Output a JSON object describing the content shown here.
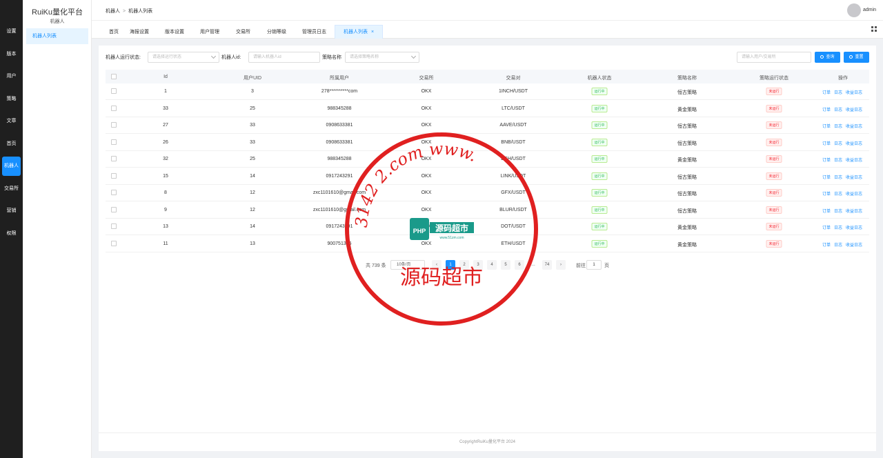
{
  "nav": {
    "items": [
      "设置",
      "版本",
      "用户",
      "策略",
      "文章",
      "首页",
      "机器人",
      "交易所",
      "营销",
      "权限"
    ],
    "active": "机器人"
  },
  "sidebar": {
    "brand": "RuiKu量化平台",
    "section": "机器人",
    "menu": "机器人列表"
  },
  "header": {
    "breadcrumb": [
      "机器人",
      "机器人列表"
    ],
    "separator": ">",
    "user": "admin"
  },
  "tabs": [
    {
      "label": "首页"
    },
    {
      "label": "海报设置"
    },
    {
      "label": "版本设置"
    },
    {
      "label": "用户管理"
    },
    {
      "label": "交易所"
    },
    {
      "label": "分销等级"
    },
    {
      "label": "管理员日志"
    },
    {
      "label": "机器人列表",
      "close": "×"
    }
  ],
  "filters": {
    "status_label": "机器人运行状态:",
    "status_placeholder": "请选择运行状态",
    "robot_id_label": "机器人id:",
    "robot_id_placeholder": "请输入机器人id",
    "strategy_label": "策略名称",
    "strategy_placeholder": "请选择策略名称",
    "user_search_placeholder": "请输入用户/交易所",
    "search_button": "查询",
    "reset_button": "重置"
  },
  "table": {
    "columns": [
      "Id",
      "用户UID",
      "所属用户",
      "交易所",
      "交易对",
      "机器人状态",
      "策略名称",
      "策略运行状态",
      "操作"
    ],
    "actions": [
      "订单",
      "日志",
      "收益日志"
    ],
    "rows": [
      {
        "id": "1",
        "uid": "3",
        "user": "278**********com",
        "exchange": "OKX",
        "pair": "1INCH/USDT",
        "robot_status": "运行中",
        "strategy": "恒古策略",
        "strategy_status": "未运行"
      },
      {
        "id": "33",
        "uid": "25",
        "user": "988345288",
        "exchange": "OKX",
        "pair": "LTC/USDT",
        "robot_status": "运行中",
        "strategy": "黄金策略",
        "strategy_status": "未运行"
      },
      {
        "id": "27",
        "uid": "33",
        "user": "0908633381",
        "exchange": "OKX",
        "pair": "AAVE/USDT",
        "robot_status": "运行中",
        "strategy": "恒古策略",
        "strategy_status": "未运行"
      },
      {
        "id": "26",
        "uid": "33",
        "user": "0908633381",
        "exchange": "OKX",
        "pair": "BNB/USDT",
        "robot_status": "运行中",
        "strategy": "恒古策略",
        "strategy_status": "未运行"
      },
      {
        "id": "32",
        "uid": "25",
        "user": "988345288",
        "exchange": "OKX",
        "pair": "BCH/USDT",
        "robot_status": "运行中",
        "strategy": "黄金策略",
        "strategy_status": "未运行"
      },
      {
        "id": "15",
        "uid": "14",
        "user": "0917243291",
        "exchange": "OKX",
        "pair": "LINK/USDT",
        "robot_status": "运行中",
        "strategy": "恒古策略",
        "strategy_status": "未运行"
      },
      {
        "id": "8",
        "uid": "12",
        "user": "zxc1101610@gmail.com",
        "exchange": "OKX",
        "pair": "GFX/USDT",
        "robot_status": "运行中",
        "strategy": "恒古策略",
        "strategy_status": "未运行"
      },
      {
        "id": "9",
        "uid": "12",
        "user": "zxc1101610@gmail.com",
        "exchange": "OKX",
        "pair": "BLUR/USDT",
        "robot_status": "运行中",
        "strategy": "恒古策略",
        "strategy_status": "未运行"
      },
      {
        "id": "13",
        "uid": "14",
        "user": "0917243291",
        "exchange": "OKX",
        "pair": "DOT/USDT",
        "robot_status": "运行中",
        "strategy": "黄金策略",
        "strategy_status": "未运行"
      },
      {
        "id": "11",
        "uid": "13",
        "user": "900751395",
        "exchange": "OKX",
        "pair": "ETH/USDT",
        "robot_status": "运行中",
        "strategy": "黄金策略",
        "strategy_status": "未运行"
      }
    ]
  },
  "pagination": {
    "total": "共 739 条",
    "page_size": "10条/页",
    "prev": "‹",
    "pages": [
      "1",
      "2",
      "3",
      "4",
      "5",
      "6",
      "…",
      "74"
    ],
    "next": "›",
    "goto_label": "前往",
    "goto_value": "1",
    "goto_unit": "页"
  },
  "footer": "CopyrightRuiKu量化平台 2024",
  "watermark": {
    "ring_text": "13142 2.com www.",
    "center": "源码超市",
    "badge": "PHP",
    "badge_sub": "www.51zm.com"
  },
  "colors": {
    "primary": "#1890ff",
    "nav_bg": "#1f1f1f",
    "success": "#2fbb5a",
    "danger": "#f5222d",
    "stamp": "#e02020"
  }
}
